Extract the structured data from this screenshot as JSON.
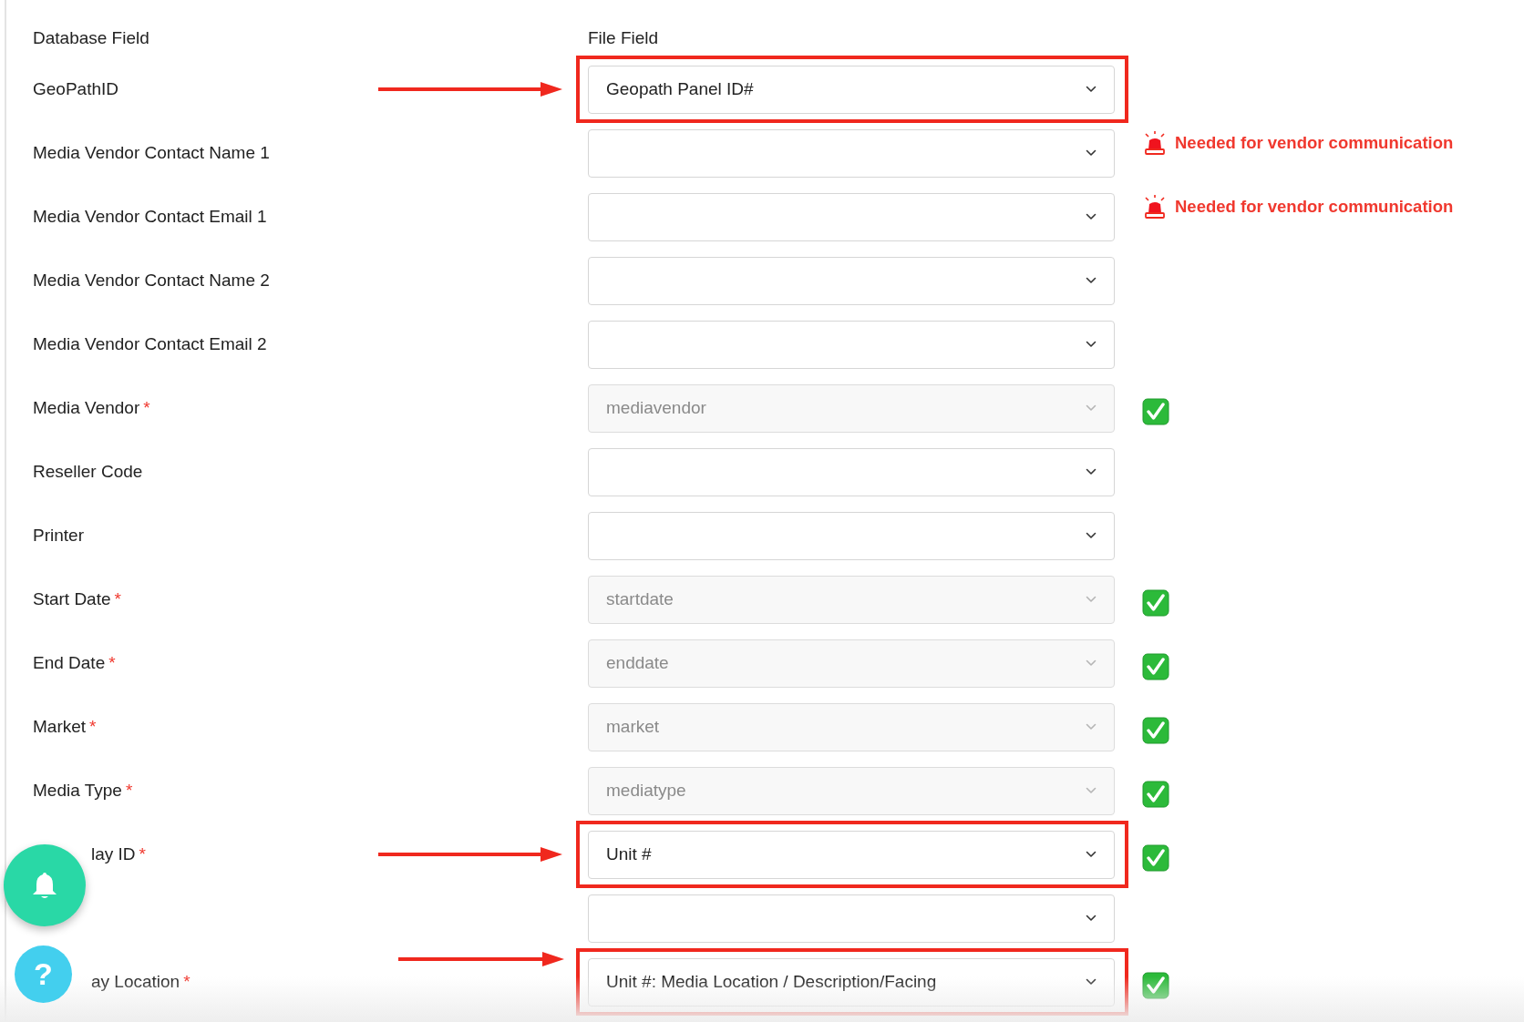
{
  "headers": {
    "database_field": "Database Field",
    "file_field": "File Field"
  },
  "rows": [
    {
      "label": "GeoPathID",
      "value": "Geopath Panel ID#",
      "disabled": false,
      "highlighted": true,
      "status": {
        "kind": "none"
      }
    },
    {
      "label": "Media Vendor Contact Name 1",
      "disabled": false,
      "highlighted": false,
      "status": {
        "kind": "warning",
        "message": "Needed for vendor communication"
      }
    },
    {
      "label": "Media Vendor Contact Email 1",
      "disabled": false,
      "highlighted": false,
      "status": {
        "kind": "warning",
        "message": "Needed for vendor communication"
      }
    },
    {
      "label": "Media Vendor Contact Name 2",
      "disabled": false,
      "highlighted": false,
      "status": {
        "kind": "none"
      }
    },
    {
      "label": "Media Vendor Contact Email 2",
      "disabled": false,
      "highlighted": false,
      "status": {
        "kind": "none"
      }
    },
    {
      "label": "Media Vendor",
      "required_mark": "*",
      "value": "mediavendor",
      "disabled": true,
      "highlighted": false,
      "status": {
        "kind": "check"
      }
    },
    {
      "label": "Reseller Code",
      "disabled": false,
      "highlighted": false,
      "status": {
        "kind": "none"
      }
    },
    {
      "label": "Printer",
      "disabled": false,
      "highlighted": false,
      "status": {
        "kind": "none"
      }
    },
    {
      "label": "Start Date",
      "required_mark": "*",
      "value": "startdate",
      "disabled": true,
      "highlighted": false,
      "status": {
        "kind": "check"
      }
    },
    {
      "label": "End Date",
      "required_mark": "*",
      "value": "enddate",
      "disabled": true,
      "highlighted": false,
      "status": {
        "kind": "check"
      }
    },
    {
      "label": "Market",
      "required_mark": "*",
      "value": "market",
      "disabled": true,
      "highlighted": false,
      "status": {
        "kind": "check"
      }
    },
    {
      "label": "Media Type",
      "required_mark": "*",
      "value": "mediatype",
      "disabled": true,
      "highlighted": false,
      "status": {
        "kind": "check"
      }
    },
    {
      "label": "lay ID",
      "required_mark": "*",
      "value": "Unit #",
      "disabled": false,
      "highlighted": true,
      "status": {
        "kind": "check"
      }
    },
    {
      "disabled": false,
      "highlighted": false,
      "status": {
        "kind": "none"
      }
    },
    {
      "label": "ay Location",
      "required_mark": "*",
      "value": "Unit #: Media Location / Description/Facing",
      "disabled": false,
      "highlighted": true,
      "status": {
        "kind": "check"
      }
    }
  ],
  "floating_buttons": [
    {
      "kind": "bell"
    },
    {
      "kind": "help",
      "label": "?"
    }
  ]
}
